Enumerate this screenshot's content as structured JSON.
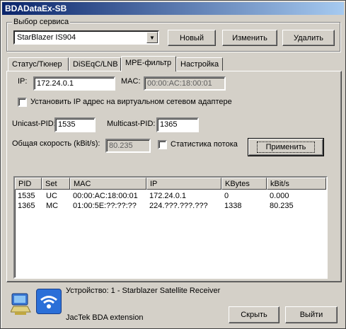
{
  "window": {
    "title": "BDADataEx-SB"
  },
  "service": {
    "group_label": "Выбор сервиса",
    "selected": "StarBlazer IS904",
    "new_label": "Новый",
    "edit_label": "Изменить",
    "delete_label": "Удалить"
  },
  "tabs": [
    {
      "label": "Статус/Тюнер"
    },
    {
      "label": "DiSEqC/LNB"
    },
    {
      "label": "MPE-фильтр"
    },
    {
      "label": "Настройка"
    }
  ],
  "mpe": {
    "ip_label": "IP:",
    "ip_value": "172.24.0.1",
    "mac_label": "MAC:",
    "mac_value": "00:00:AC:18:00:01",
    "set_ip_label": "Установить IP адрес на виртуальном сетевом адаптере",
    "unicast_label": "Unicast-PID:",
    "unicast_value": "1535",
    "multicast_label": "Multicast-PID:",
    "multicast_value": "1365",
    "speed_label": "Общая скорость (kBit/s):",
    "speed_value": "80.235",
    "stats_label": "Статистика потока",
    "apply_label": "Применить"
  },
  "table": {
    "columns": [
      "PID",
      "Set",
      "MAC",
      "IP",
      "KBytes",
      "kBit/s"
    ],
    "rows": [
      [
        "1535",
        "UC",
        "00:00:AC:18:00:01",
        "172.24.0.1",
        "0",
        "0.000"
      ],
      [
        "1365",
        "MC",
        "01:00:5E:??:??:??",
        "224.???.???.???",
        "1338",
        "80.235"
      ]
    ]
  },
  "footer": {
    "device": "Устройство: 1 - Starblazer Satellite Receiver",
    "extension": "JacTek BDA extension",
    "hide_label": "Скрыть",
    "exit_label": "Выйти"
  }
}
